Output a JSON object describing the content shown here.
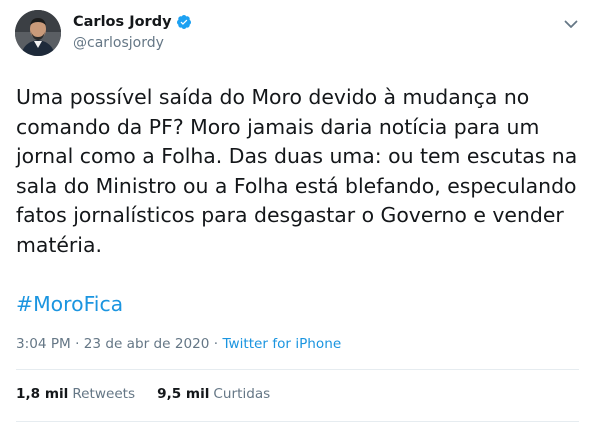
{
  "user": {
    "name": "Carlos Jordy",
    "handle": "@carlosjordy"
  },
  "tweet": {
    "lines": [
      "Uma possível saída do Moro devido à mudança no",
      "comando da PF? Moro jamais daria notícia para um",
      "jornal como a Folha. Das duas uma: ou tem escutas na",
      "sala do Ministro ou a Folha está blefando, especulando",
      "fatos jornalísticos para desgastar o Governo e vender",
      "matéria."
    ],
    "hashtag": "#MoroFica"
  },
  "meta": {
    "time": "3:04 PM",
    "separator1": " · ",
    "date": "23 de abr de 2020",
    "separator2": " · ",
    "source": "Twitter for iPhone"
  },
  "stats": {
    "retweets_count": "1,8 mil",
    "retweets_label": "Retweets",
    "likes_count": "9,5 mil",
    "likes_label": "Curtidas"
  },
  "colors": {
    "link": "#1b95e0",
    "secondary_text": "#657786",
    "verified_badge": "#1da1f2"
  },
  "icons": {
    "verified": "verified-badge-icon",
    "more": "chevron-down-icon"
  }
}
